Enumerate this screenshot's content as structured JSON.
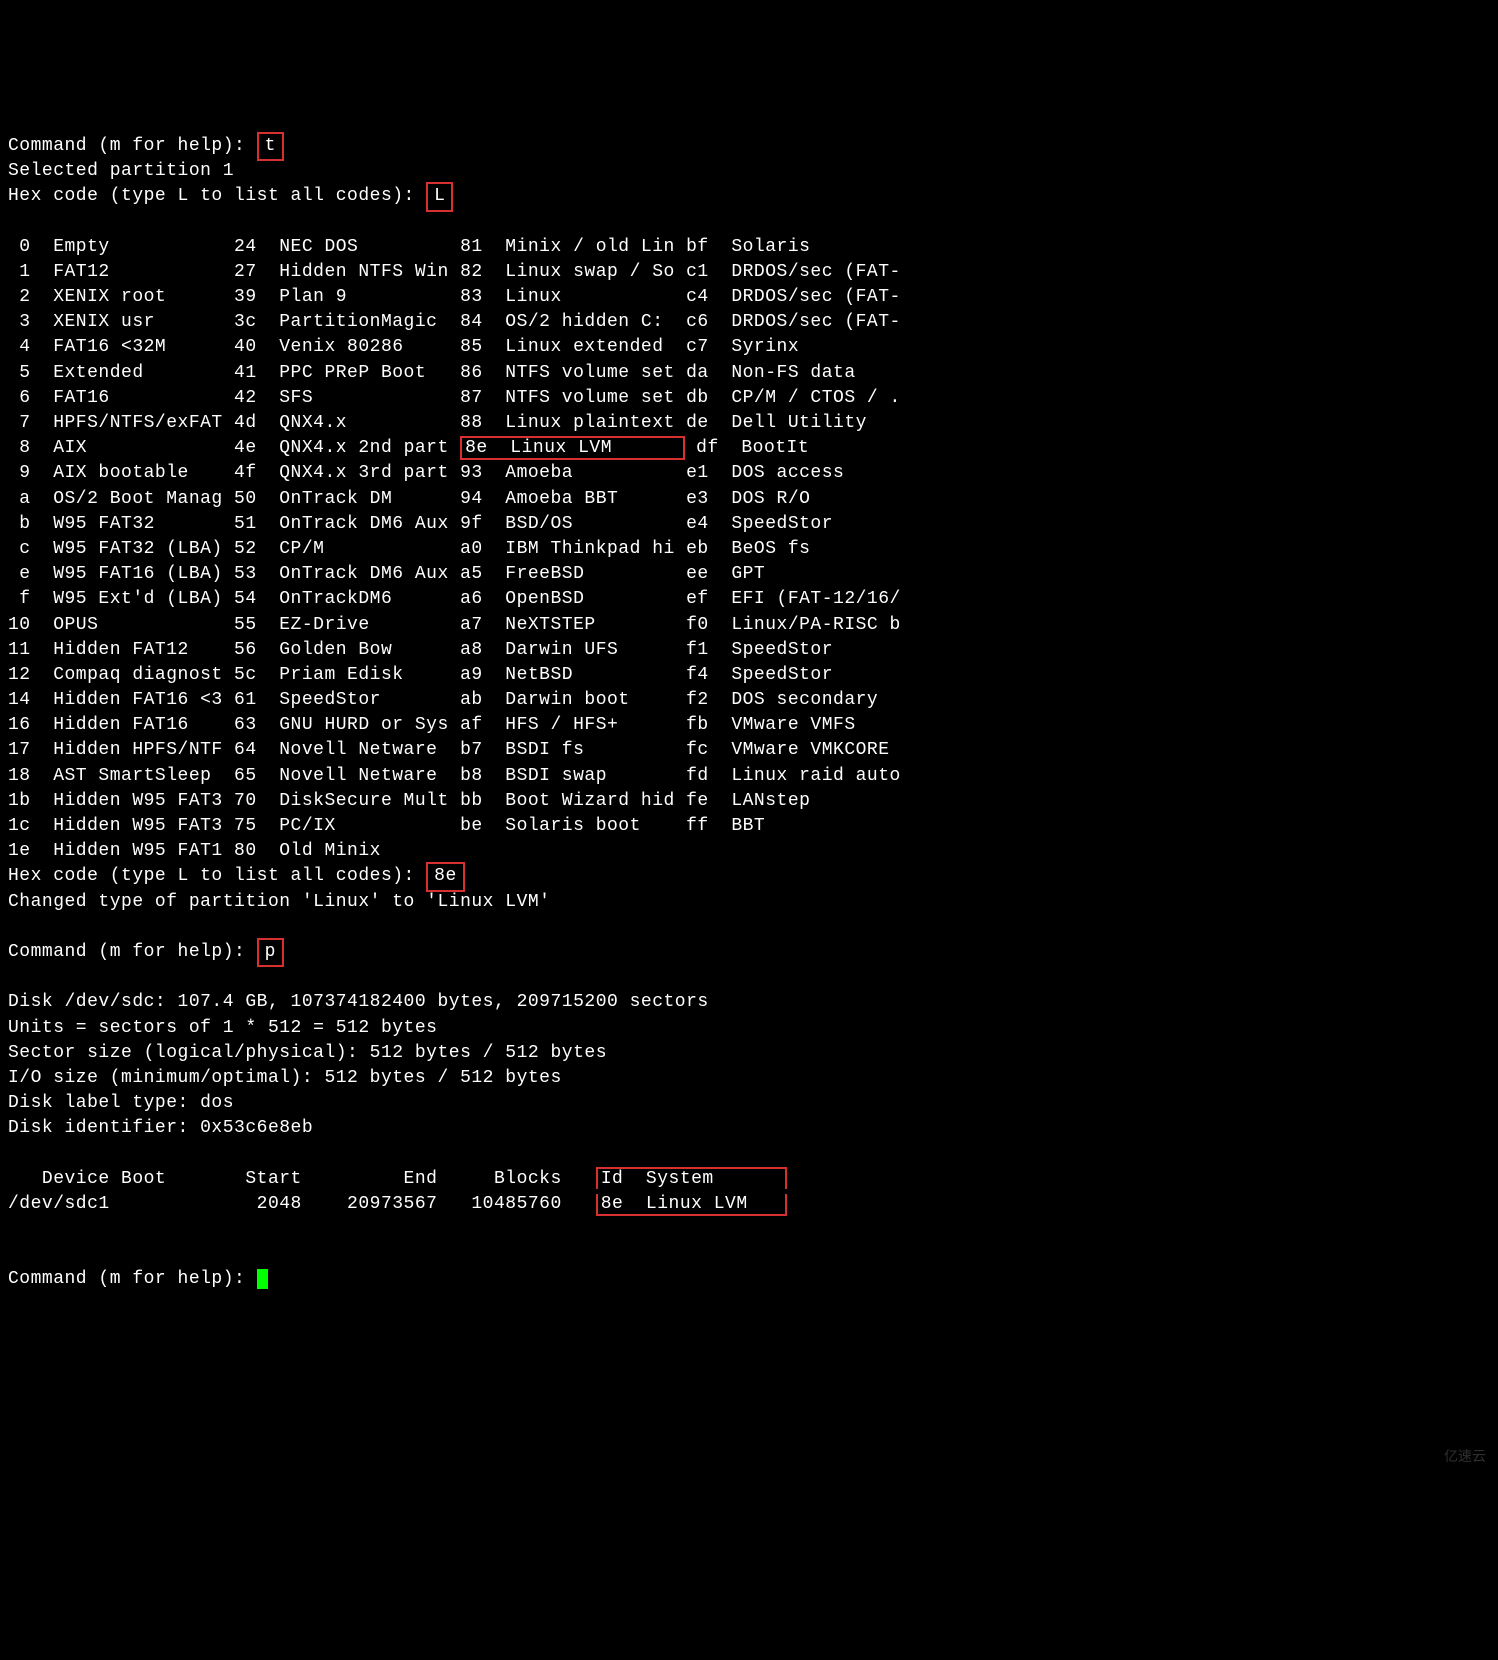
{
  "prompts": {
    "cmd": "Command (m for help): ",
    "hex": "Hex code (type L to list all codes): "
  },
  "inputs": {
    "t": "t",
    "L": "L",
    "eighte": "8e",
    "p": "p"
  },
  "messages": {
    "selected": "Selected partition 1",
    "changed": "Changed type of partition 'Linux' to 'Linux LVM'"
  },
  "hex_table": [
    {
      "a": "0",
      "an": "Empty",
      "b": "24",
      "bn": "NEC DOS",
      "c": "81",
      "cn": "Minix / old Lin",
      "d": "bf",
      "dn": "Solaris"
    },
    {
      "a": "1",
      "an": "FAT12",
      "b": "27",
      "bn": "Hidden NTFS Win",
      "c": "82",
      "cn": "Linux swap / So",
      "d": "c1",
      "dn": "DRDOS/sec (FAT-"
    },
    {
      "a": "2",
      "an": "XENIX root",
      "b": "39",
      "bn": "Plan 9",
      "c": "83",
      "cn": "Linux",
      "d": "c4",
      "dn": "DRDOS/sec (FAT-"
    },
    {
      "a": "3",
      "an": "XENIX usr",
      "b": "3c",
      "bn": "PartitionMagic",
      "c": "84",
      "cn": "OS/2 hidden C:",
      "d": "c6",
      "dn": "DRDOS/sec (FAT-"
    },
    {
      "a": "4",
      "an": "FAT16 <32M",
      "b": "40",
      "bn": "Venix 80286",
      "c": "85",
      "cn": "Linux extended",
      "d": "c7",
      "dn": "Syrinx"
    },
    {
      "a": "5",
      "an": "Extended",
      "b": "41",
      "bn": "PPC PReP Boot",
      "c": "86",
      "cn": "NTFS volume set",
      "d": "da",
      "dn": "Non-FS data"
    },
    {
      "a": "6",
      "an": "FAT16",
      "b": "42",
      "bn": "SFS",
      "c": "87",
      "cn": "NTFS volume set",
      "d": "db",
      "dn": "CP/M / CTOS / ."
    },
    {
      "a": "7",
      "an": "HPFS/NTFS/exFAT",
      "b": "4d",
      "bn": "QNX4.x",
      "c": "88",
      "cn": "Linux plaintext",
      "d": "de",
      "dn": "Dell Utility"
    },
    {
      "a": "8",
      "an": "AIX",
      "b": "4e",
      "bn": "QNX4.x 2nd part",
      "c": "8e",
      "cn": "Linux LVM",
      "d": "df",
      "dn": "BootIt",
      "highlight": true
    },
    {
      "a": "9",
      "an": "AIX bootable",
      "b": "4f",
      "bn": "QNX4.x 3rd part",
      "c": "93",
      "cn": "Amoeba",
      "d": "e1",
      "dn": "DOS access"
    },
    {
      "a": "a",
      "an": "OS/2 Boot Manag",
      "b": "50",
      "bn": "OnTrack DM",
      "c": "94",
      "cn": "Amoeba BBT",
      "d": "e3",
      "dn": "DOS R/O"
    },
    {
      "a": "b",
      "an": "W95 FAT32",
      "b": "51",
      "bn": "OnTrack DM6 Aux",
      "c": "9f",
      "cn": "BSD/OS",
      "d": "e4",
      "dn": "SpeedStor"
    },
    {
      "a": "c",
      "an": "W95 FAT32 (LBA)",
      "b": "52",
      "bn": "CP/M",
      "c": "a0",
      "cn": "IBM Thinkpad hi",
      "d": "eb",
      "dn": "BeOS fs"
    },
    {
      "a": "e",
      "an": "W95 FAT16 (LBA)",
      "b": "53",
      "bn": "OnTrack DM6 Aux",
      "c": "a5",
      "cn": "FreeBSD",
      "d": "ee",
      "dn": "GPT"
    },
    {
      "a": "f",
      "an": "W95 Ext'd (LBA)",
      "b": "54",
      "bn": "OnTrackDM6",
      "c": "a6",
      "cn": "OpenBSD",
      "d": "ef",
      "dn": "EFI (FAT-12/16/"
    },
    {
      "a": "10",
      "an": "OPUS",
      "b": "55",
      "bn": "EZ-Drive",
      "c": "a7",
      "cn": "NeXTSTEP",
      "d": "f0",
      "dn": "Linux/PA-RISC b"
    },
    {
      "a": "11",
      "an": "Hidden FAT12",
      "b": "56",
      "bn": "Golden Bow",
      "c": "a8",
      "cn": "Darwin UFS",
      "d": "f1",
      "dn": "SpeedStor"
    },
    {
      "a": "12",
      "an": "Compaq diagnost",
      "b": "5c",
      "bn": "Priam Edisk",
      "c": "a9",
      "cn": "NetBSD",
      "d": "f4",
      "dn": "SpeedStor"
    },
    {
      "a": "14",
      "an": "Hidden FAT16 <3",
      "b": "61",
      "bn": "SpeedStor",
      "c": "ab",
      "cn": "Darwin boot",
      "d": "f2",
      "dn": "DOS secondary"
    },
    {
      "a": "16",
      "an": "Hidden FAT16",
      "b": "63",
      "bn": "GNU HURD or Sys",
      "c": "af",
      "cn": "HFS / HFS+",
      "d": "fb",
      "dn": "VMware VMFS"
    },
    {
      "a": "17",
      "an": "Hidden HPFS/NTF",
      "b": "64",
      "bn": "Novell Netware",
      "c": "b7",
      "cn": "BSDI fs",
      "d": "fc",
      "dn": "VMware VMKCORE"
    },
    {
      "a": "18",
      "an": "AST SmartSleep",
      "b": "65",
      "bn": "Novell Netware",
      "c": "b8",
      "cn": "BSDI swap",
      "d": "fd",
      "dn": "Linux raid auto"
    },
    {
      "a": "1b",
      "an": "Hidden W95 FAT3",
      "b": "70",
      "bn": "DiskSecure Mult",
      "c": "bb",
      "cn": "Boot Wizard hid",
      "d": "fe",
      "dn": "LANstep"
    },
    {
      "a": "1c",
      "an": "Hidden W95 FAT3",
      "b": "75",
      "bn": "PC/IX",
      "c": "be",
      "cn": "Solaris boot",
      "d": "ff",
      "dn": "BBT"
    },
    {
      "a": "1e",
      "an": "Hidden W95 FAT1",
      "b": "80",
      "bn": "Old Minix",
      "c": "",
      "cn": "",
      "d": "",
      "dn": ""
    }
  ],
  "disk_info": [
    "Disk /dev/sdc: 107.4 GB, 107374182400 bytes, 209715200 sectors",
    "Units = sectors of 1 * 512 = 512 bytes",
    "Sector size (logical/physical): 512 bytes / 512 bytes",
    "I/O size (minimum/optimal): 512 bytes / 512 bytes",
    "Disk label type: dos",
    "Disk identifier: 0x53c6e8eb"
  ],
  "part_header": {
    "device": "Device",
    "boot": "Boot",
    "start": "Start",
    "end": "End",
    "blocks": "Blocks",
    "id": "Id",
    "system": "System"
  },
  "part_row": {
    "device": "/dev/sdc1",
    "boot": "",
    "start": "2048",
    "end": "20973567",
    "blocks": "10485760",
    "id": "8e",
    "system": "Linux LVM"
  },
  "watermark": "亿速云"
}
